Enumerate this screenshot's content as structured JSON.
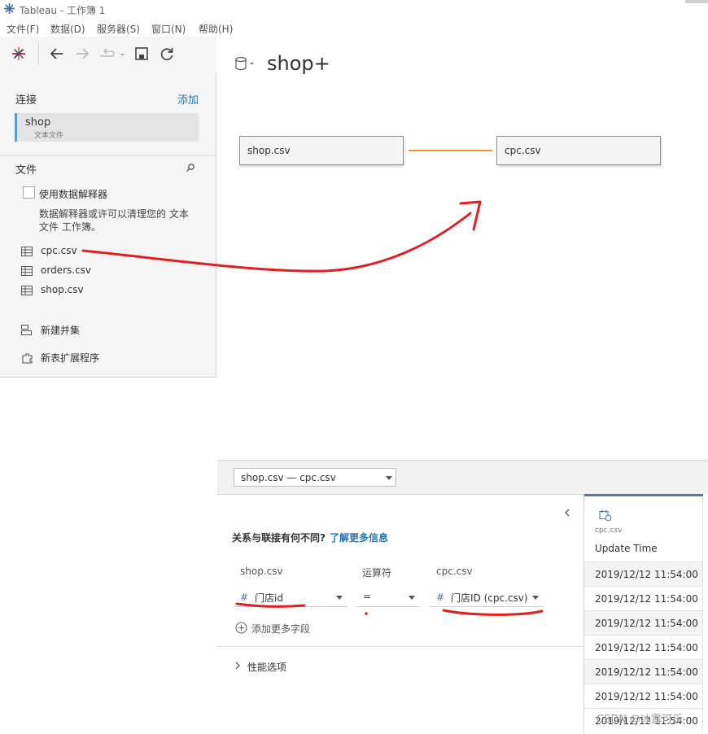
{
  "window": {
    "title": "Tableau - 工作簿 1"
  },
  "menu": [
    "文件(F)",
    "数据(D)",
    "服务器(S)",
    "窗口(N)",
    "帮助(H)"
  ],
  "left_pane": {
    "connections_label": "连接",
    "add_label": "添加",
    "connection": {
      "name": "shop",
      "type": "文本文件"
    },
    "files_label": "文件",
    "interpreter_label": "使用数据解释器",
    "interpreter_desc_line1": "数据解释器或许可以清理您的 文本",
    "interpreter_desc_line2": "文件 工作簿。",
    "files": [
      "cpc.csv",
      "orders.csv",
      "shop.csv"
    ],
    "new_union": "新建并集",
    "new_extension": "新表扩展程序"
  },
  "canvas": {
    "datasource_title": "shop+",
    "left_table": "shop.csv",
    "right_table": "cpc.csv"
  },
  "relationship": {
    "selector": "shop.csv  —  cpc.csv",
    "question": "关系与联接有何不同?",
    "learn_more": "了解更多信息",
    "left_header": "shop.csv",
    "operator_header": "运算符",
    "right_header": "cpc.csv",
    "left_field": "门店id",
    "operator": "=",
    "right_field": "门店ID (cpc.csv)",
    "add_more": "添加更多字段",
    "performance": "性能选项"
  },
  "grid": {
    "source": "cpc.csv",
    "column": "Update Time",
    "rows": [
      "2019/12/12 11:54:00",
      "2019/12/12 11:54:00",
      "2019/12/12 11:54:00",
      "2019/12/12 11:54:00",
      "2019/12/12 11:54:00",
      "2019/12/12 11:54:00",
      "2019/12/12 11:54:00"
    ]
  },
  "watermark": "CSDN @冰露可乐",
  "colors": {
    "accent_blue": "#1f77b4",
    "relationship_line": "#f28e2b",
    "annotation_red": "#e02020",
    "connection_bar": "#5b9bd5"
  }
}
